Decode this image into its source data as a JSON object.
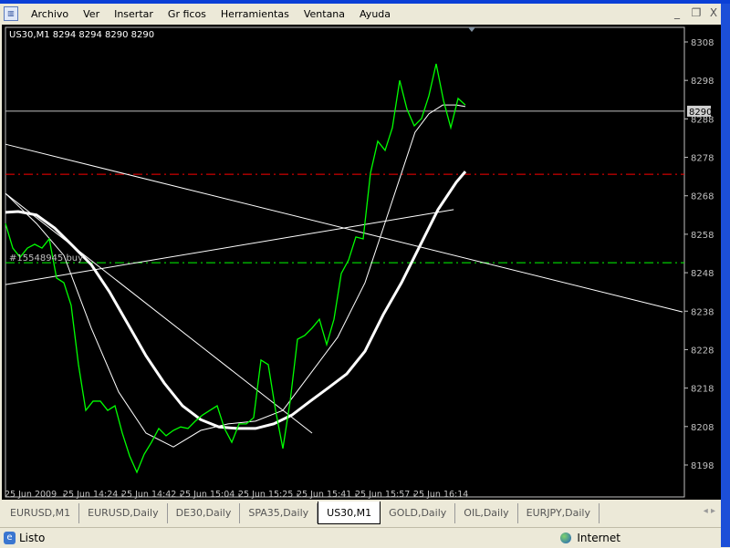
{
  "menu": {
    "items": [
      "Archivo",
      "Ver",
      "Insertar",
      "Gr ficos",
      "Herramientas",
      "Ventana",
      "Ayuda"
    ]
  },
  "window_controls": {
    "minimize": "_",
    "restore": "❐",
    "close": "X"
  },
  "chart": {
    "header": "US30,M1  8294 8294 8290 8290",
    "order_label": "#15548945 buy",
    "current_price_label": "8290",
    "price_ticks": [
      "8308",
      "8298",
      "8288",
      "8278",
      "8268",
      "8258",
      "8248",
      "8238",
      "8228",
      "8218",
      "8208",
      "8198"
    ],
    "time_ticks": [
      "25 Jun 2009",
      "25 Jun 14:24",
      "25 Jun 14:42",
      "25 Jun 15:04",
      "25 Jun 15:25",
      "25 Jun 15:41",
      "25 Jun 15:57",
      "25 Jun 16:14"
    ]
  },
  "chart_data": {
    "type": "line",
    "symbol": "US30",
    "timeframe": "M1",
    "ylim": [
      8196,
      8310
    ],
    "xlim": [
      0,
      92.75
    ],
    "price": [
      8260.8,
      8254.4,
      8252.0,
      8254.4,
      8255.4,
      8254.4,
      8256.8,
      8246.6,
      8245.4,
      8239.5,
      8224.1,
      8212.2,
      8214.6,
      8214.6,
      8212.2,
      8213.4,
      8206.3,
      8200.4,
      8196.1,
      8200.8,
      8203.9,
      8207.5,
      8205.6,
      8207.0,
      8207.9,
      8207.5,
      8209.4,
      8211.0,
      8212.2,
      8213.4,
      8207.5,
      8203.9,
      8208.7,
      8208.7,
      8210.3,
      8225.3,
      8224.1,
      8212.2,
      8202.3,
      8214.6,
      8230.7,
      8231.7,
      8233.6,
      8235.9,
      8229.3,
      8235.9,
      8247.8,
      8251.3,
      8257.3,
      8256.8,
      8273.9,
      8282.2,
      8279.8,
      8285.7,
      8298.0,
      8290.5,
      8286.2,
      8288.1,
      8294.0,
      8302.3,
      8292.8,
      8285.7,
      8293.3,
      8291.6
    ],
    "ma_fast": {
      "x": [
        0,
        4.25,
        8,
        11.75,
        15.5,
        19.25,
        23,
        26.75,
        30.5,
        34.25,
        38,
        41.75,
        45.5,
        49.25,
        51.75,
        54.25,
        56.1,
        58,
        59.9,
        61.75,
        63
      ],
      "y": [
        8268.6,
        8260.8,
        8252.5,
        8233.6,
        8217.0,
        8206.3,
        8202.7,
        8207.0,
        8208.7,
        8209.4,
        8212.2,
        8221.7,
        8231.2,
        8245.4,
        8259.6,
        8273.9,
        8284.5,
        8289.3,
        8291.6,
        8291.6,
        8291.2
      ]
    },
    "ma_slow": {
      "x": [
        0,
        1.75,
        4.25,
        6.75,
        9.25,
        11.75,
        14.25,
        16.75,
        19.25,
        21.75,
        24.25,
        26.75,
        29.25,
        31.75,
        34.25,
        36.75,
        39.25,
        41.75,
        44.25,
        46.75,
        49.25,
        51.75,
        54.25,
        56.75,
        59.25,
        61.75,
        63
      ],
      "y": [
        8263.7,
        8263.9,
        8263.0,
        8259.6,
        8254.9,
        8250.1,
        8243.0,
        8234.7,
        8226.4,
        8219.3,
        8213.4,
        8209.8,
        8207.9,
        8207.5,
        8207.5,
        8208.7,
        8211.0,
        8214.6,
        8218.1,
        8221.7,
        8227.6,
        8237.1,
        8245.4,
        8254.9,
        8264.4,
        8271.5,
        8274.3
      ]
    },
    "trendlines": [
      {
        "x": [
          0,
          92.75
        ],
        "y": [
          8281.4,
          8237.8
        ]
      },
      {
        "x": [
          0,
          61.4
        ],
        "y": [
          8244.9,
          8264.4
        ]
      },
      {
        "x": [
          0,
          42
        ],
        "y": [
          8268.6,
          8206.3
        ]
      }
    ],
    "levels": {
      "current": 8290,
      "stop_red": 8273.6,
      "order_green": 8250.6
    },
    "colors": {
      "price": "#00ff00",
      "ma": "#ffffff",
      "red": "#ff0000",
      "green": "#00ff00",
      "current": "#c0c0c0"
    }
  },
  "tabs": {
    "items": [
      "EURUSD,M1",
      "EURUSD,Daily",
      "DE30,Daily",
      "SPA35,Daily",
      "US30,M1",
      "GOLD,Daily",
      "OIL,Daily",
      "EURJPY,Daily"
    ],
    "active": 4
  },
  "status": {
    "text": "Listo",
    "zone": "Internet"
  }
}
